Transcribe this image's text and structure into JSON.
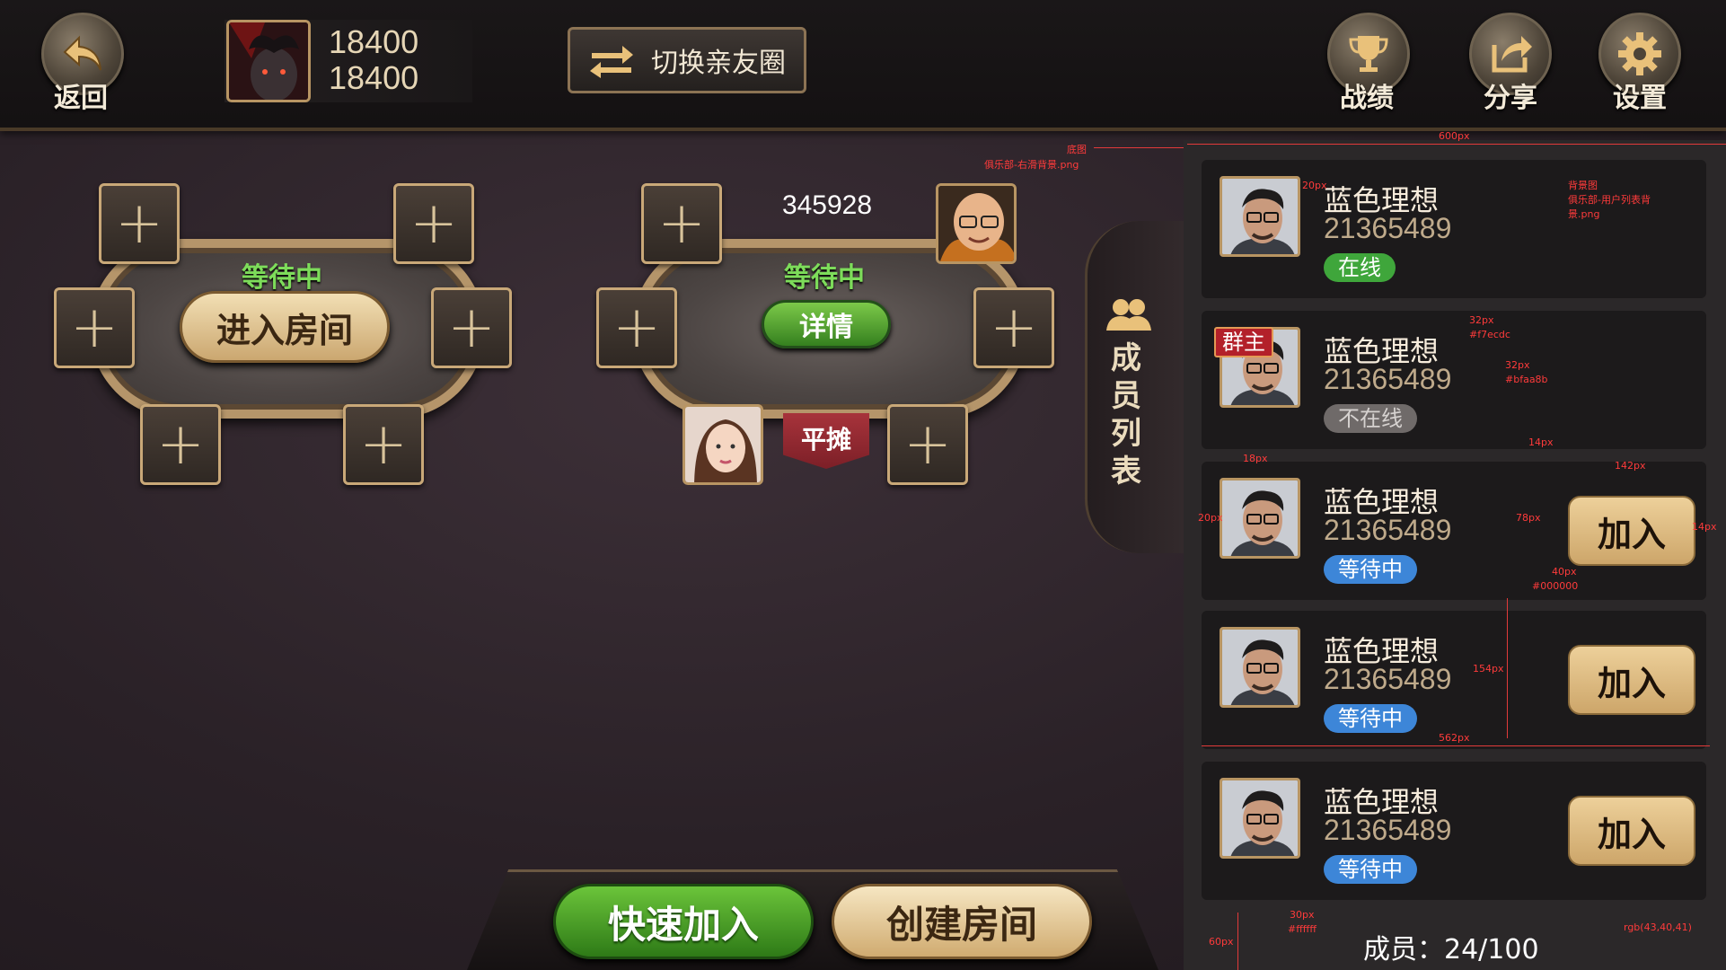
{
  "topbar": {
    "back_label": "返回",
    "coins_primary": "18400",
    "coins_secondary": "18400",
    "switch_label": "切换亲友圈",
    "record_label": "战绩",
    "share_label": "分享",
    "settings_label": "设置"
  },
  "table1": {
    "status": "等待中",
    "enter_label": "进入房间"
  },
  "table2": {
    "room_number": "345928",
    "status": "等待中",
    "detail_label": "详情",
    "flag_label": "平摊"
  },
  "seat_symbol": "+",
  "member_tab": {
    "chars": [
      "成",
      "员",
      "列",
      "表"
    ]
  },
  "members": [
    {
      "name": "蓝色理想",
      "id": "21365489",
      "status": "在线",
      "status_type": "online",
      "owner": false,
      "join": false
    },
    {
      "name": "蓝色理想",
      "id": "21365489",
      "status": "不在线",
      "status_type": "offline",
      "owner": true,
      "join": false
    },
    {
      "name": "蓝色理想",
      "id": "21365489",
      "status": "等待中",
      "status_type": "wait",
      "owner": false,
      "join": true
    },
    {
      "name": "蓝色理想",
      "id": "21365489",
      "status": "等待中",
      "status_type": "wait",
      "owner": false,
      "join": true
    },
    {
      "name": "蓝色理想",
      "id": "21365489",
      "status": "等待中",
      "status_type": "wait",
      "owner": false,
      "join": true
    }
  ],
  "owner_label": "群主",
  "join_label": "加入",
  "bottom": {
    "quick_join_label": "快速加入",
    "create_room_label": "创建房间"
  },
  "member_count_label": "成员：24/100",
  "annotations": {
    "bg_label": "底图",
    "bg_file": "俱乐部-右滑背景.png",
    "width_600": "600px",
    "card_bg_label": "背景图",
    "card_bg_file_1": "俱乐部-用户列表背",
    "card_bg_file_2": "景.png",
    "name_size": "32px",
    "name_color": "#f7ecdc",
    "id_size": "32px",
    "id_color": "#bfaa8b",
    "gap_20": "20px",
    "gap_14a": "14px",
    "gap_18": "18px",
    "width_142": "142px",
    "height_78": "78px",
    "gap_20b": "20px",
    "gap_14b": "14px",
    "join_size": "40px",
    "join_color": "#000000",
    "height_154": "154px",
    "width_562": "562px",
    "height_60": "60px",
    "count_size": "30px",
    "count_color": "#ffffff",
    "footer_color": "rgb(43,40,41)"
  },
  "colors": {
    "panel_bg": "#2b2829",
    "name": "#f7ecdc",
    "id": "#bfaa8b",
    "online": "#3fa63b",
    "wait": "#3d86d8",
    "gold": "#cda66a"
  }
}
